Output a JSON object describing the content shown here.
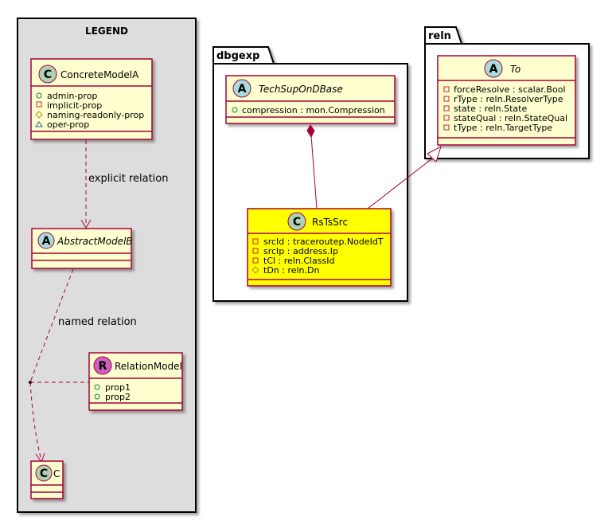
{
  "colors": {
    "class_fill": "#FEFECE",
    "class_border": "#A80036",
    "highlight_fill": "#FFFF00",
    "legend_fill": "#DDDDDD",
    "circle_c": "#ADD1B2",
    "circle_a": "#A9DCDF",
    "circle_r": "#D060C0"
  },
  "legend": {
    "title": "LEGEND",
    "concrete": {
      "stereo": "C",
      "name": "ConcreteModelA",
      "props": [
        "admin-prop",
        "implicit-prop",
        "naming-readonly-prop",
        "oper-prop"
      ]
    },
    "explicit_label": "explicit relation",
    "abstract": {
      "stereo": "A",
      "name": "AbstractModelB"
    },
    "named_label": "named relation",
    "relation": {
      "stereo": "R",
      "name": "RelationModel",
      "props": [
        "prop1",
        "prop2"
      ]
    },
    "c": {
      "stereo": "C",
      "name": "C"
    }
  },
  "dbgexp": {
    "title": "dbgexp",
    "techsup": {
      "stereo": "A",
      "name": "TechSupOnDBase",
      "props": [
        "compression : mon.Compression"
      ]
    },
    "rstssrc": {
      "stereo": "C",
      "name": "RsTsSrc",
      "props": [
        "srcId : traceroutep.NodeIdT",
        "srcIp : address.Ip",
        "tCl : reln.ClassId",
        "tDn : reln.Dn"
      ]
    }
  },
  "reln": {
    "title": "reln",
    "to": {
      "stereo": "A",
      "name": "To",
      "props": [
        "forceResolve : scalar.Bool",
        "rType : reln.ResolverType",
        "state : reln.State",
        "stateQual : reln.StateQual",
        "tType : reln.TargetType"
      ]
    }
  }
}
